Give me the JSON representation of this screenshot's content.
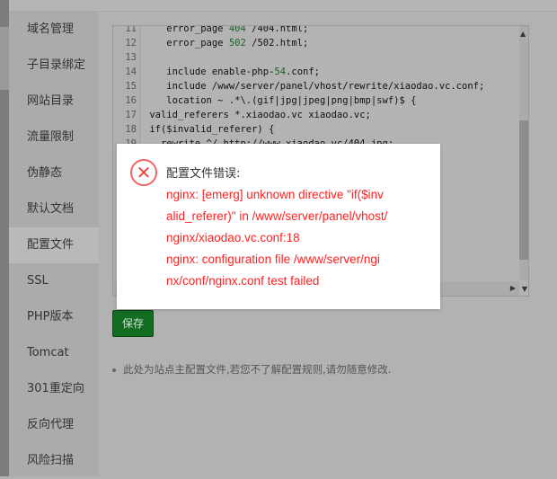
{
  "sidebar": {
    "items": [
      {
        "label": "域名管理"
      },
      {
        "label": "子目录绑定"
      },
      {
        "label": "网站目录"
      },
      {
        "label": "流量限制"
      },
      {
        "label": "伪静态"
      },
      {
        "label": "默认文档"
      },
      {
        "label": "配置文件",
        "active": true
      },
      {
        "label": "SSL"
      },
      {
        "label": "PHP版本"
      },
      {
        "label": "Tomcat"
      },
      {
        "label": "301重定向"
      },
      {
        "label": "反向代理"
      },
      {
        "label": "风险扫描"
      }
    ]
  },
  "editor": {
    "lines": [
      {
        "n": "11",
        "pre": "    error_page ",
        "num": "404",
        "post": " /404.html;"
      },
      {
        "n": "12",
        "pre": "    error_page ",
        "num": "502",
        "post": " /502.html;"
      },
      {
        "n": "13",
        "pre": "",
        "num": "",
        "post": ""
      },
      {
        "n": "14",
        "pre": "    include enable-php-",
        "num": "54",
        "post": ".conf;"
      },
      {
        "n": "15",
        "pre": "    include /www/server/panel/vhost/rewrite/xiaodao.vc.conf;",
        "num": "",
        "post": ""
      },
      {
        "n": "16",
        "pre": "    location ~ .*\\.(gif|jpg|jpeg|png|bmp|swf)$ {",
        "num": "",
        "post": ""
      },
      {
        "n": "17",
        "pre": " valid_referers *.xiaodao.vc xiaodao.vc;",
        "num": "",
        "post": ""
      },
      {
        "n": "18",
        "pre": " if($invalid_referer) {",
        "num": "",
        "post": ""
      },
      {
        "n": "19",
        "pre": "   rewrite ^/ http://www.xiaodao.vc/404.jpg;",
        "num": "",
        "post": ""
      }
    ]
  },
  "modal": {
    "icon": "error-circle-x-icon",
    "title": "配置文件错误:",
    "message_lines": [
      "nginx: [emerg] unknown directive \"if($inv",
      "alid_referer)\" in /www/server/panel/vhost/",
      "nginx/xiaodao.vc.conf:18",
      "nginx: configuration file /www/server/ngi",
      "nx/conf/nginx.conf test failed"
    ],
    "error_color": "#ff2222"
  },
  "save_label": "保存",
  "note": "此处为站点主配置文件,若您不了解配置规则,请勿随意修改.",
  "colors": {
    "save_button": "#136d21"
  }
}
